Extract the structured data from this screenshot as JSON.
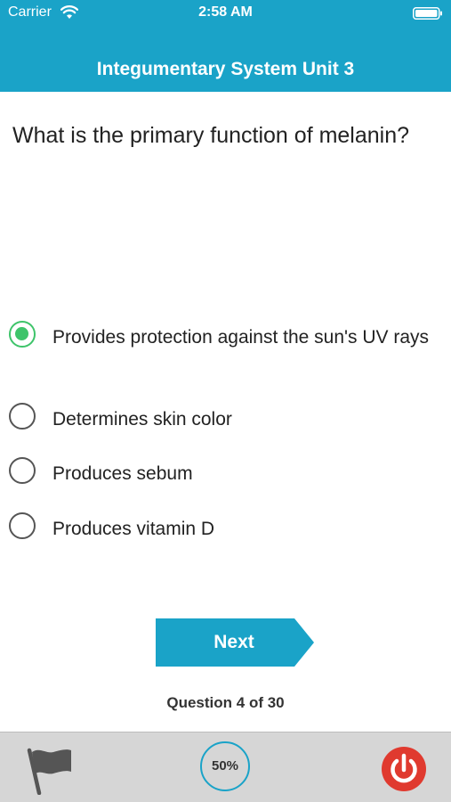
{
  "status_bar": {
    "carrier": "Carrier",
    "time": "2:58 AM"
  },
  "header": {
    "title": "Integumentary System Unit 3"
  },
  "question": {
    "text": "What is the primary function of melanin?"
  },
  "answers": [
    {
      "label": "Provides protection against the sun's UV rays",
      "selected": true
    },
    {
      "label": "Determines skin color",
      "selected": false
    },
    {
      "label": "Produces sebum",
      "selected": false
    },
    {
      "label": "Produces vitamin D",
      "selected": false
    }
  ],
  "next_button": {
    "label": "Next"
  },
  "progress": {
    "text": "Question 4 of 30"
  },
  "toolbar": {
    "percent": "50%",
    "flag_icon": "flag-icon",
    "power_icon": "power-icon"
  },
  "colors": {
    "accent": "#1aa3c8",
    "selected": "#3ec46a",
    "power": "#e03a2f",
    "toolbar_bg": "#d6d6d6"
  }
}
